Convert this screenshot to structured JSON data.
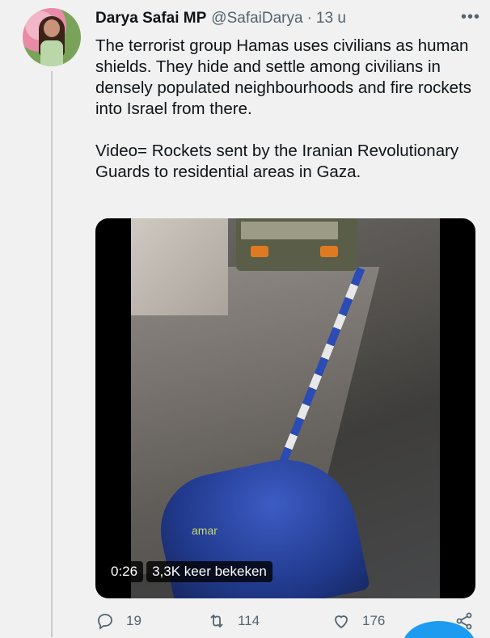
{
  "author": {
    "name": "Darya Safai MP",
    "handle": "@SafaiDarya",
    "separator": "·",
    "time": "13 u"
  },
  "more_label": "•••",
  "text": {
    "paragraph1": "The terrorist group Hamas uses civilians as human shields. They hide and settle among civilians in densely populated neighbourhoods and fire rockets into Israel from there.",
    "paragraph2": "Video= Rockets sent by the Iranian Revolutionary Guards to residential areas in Gaza."
  },
  "video": {
    "duration": "0:26",
    "views": "3,3K keer bekeken",
    "watermark": "amar"
  },
  "actions": {
    "reply_count": "19",
    "retweet_count": "114",
    "like_count": "176"
  },
  "colors": {
    "accent": "#1d9bf0",
    "secondary_text": "#536471",
    "background": "#f0f1f0"
  }
}
